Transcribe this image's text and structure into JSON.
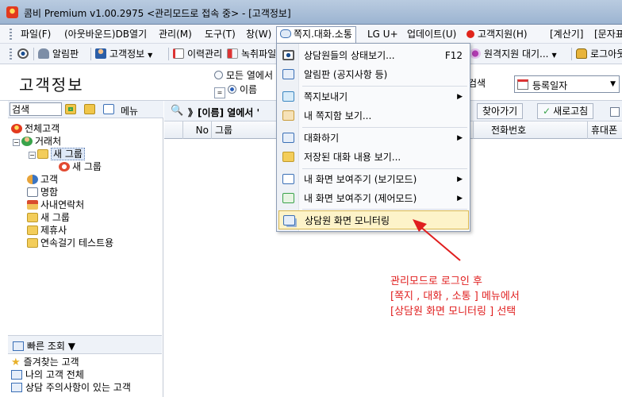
{
  "window": {
    "title": "콤비 Premium v1.00.2975 <관리모드로 접속 중> - [고객정보]"
  },
  "menubar": {
    "items": [
      {
        "label": "파일(F)"
      },
      {
        "label": "(아웃바운드)DB열기"
      },
      {
        "label": "관리(M)"
      },
      {
        "label": "도구(T)"
      },
      {
        "label": "창(W)"
      },
      {
        "label": "쪽지.대화.소통"
      },
      {
        "label": "LG U+"
      },
      {
        "label": "업데이트(U)"
      },
      {
        "label": "고객지원(H)"
      },
      {
        "label": "[계산기]"
      },
      {
        "label": "[문자표]"
      }
    ]
  },
  "toolbar": {
    "notice": "알림판",
    "customer_info": "고객정보",
    "history": "이력관리",
    "recording": "녹취파일",
    "remote": "원격지원 대기...",
    "logout": "로그아웃"
  },
  "topbar": {
    "page_title": "고객정보",
    "radio_all": "모든 열에서",
    "radio_selected": "이름",
    "right_label": "검색",
    "date_field": "등록일자"
  },
  "left": {
    "search_label": "검색",
    "menu_label": "메뉴",
    "tree": [
      {
        "label": "전체고객"
      },
      {
        "label": "거래처"
      },
      {
        "label": "새 그룹"
      },
      {
        "label": "새 그룹"
      },
      {
        "label": "고객"
      },
      {
        "label": "명함"
      },
      {
        "label": "사내연락처"
      },
      {
        "label": "새 그룹"
      },
      {
        "label": "제휴사"
      },
      {
        "label": "연속걸기 테스트용"
      }
    ],
    "quick_title": "빠른 조회 ▼",
    "quick_items": [
      {
        "label": "즐겨찾는 고객"
      },
      {
        "label": "나의 고객 전체"
      },
      {
        "label": "상담 주의사항이 있는 고객"
      }
    ]
  },
  "right": {
    "filter_hint": "》[이름] 열에서 '",
    "go_back": "찾아가기",
    "refresh": "새로고침",
    "columns": [
      {
        "label": "No"
      },
      {
        "label": "그룹"
      },
      {
        "label": "전화번호"
      },
      {
        "label": "휴대폰"
      }
    ]
  },
  "dropdown": {
    "items": [
      {
        "label": "상담원들의 상태보기...",
        "shortcut": "F12",
        "icon": "eye-icon"
      },
      {
        "label": "알림판 (공지사항 등)",
        "icon": "board-icon"
      },
      {
        "label": "쪽지보내기",
        "icon": "note-icon"
      },
      {
        "label": "내 쪽지함 보기...",
        "icon": "note-box-icon"
      },
      {
        "label": "대화하기",
        "icon": "chat-icon"
      },
      {
        "label": "저장된 대화 내용 보기...",
        "icon": "folder-icon"
      },
      {
        "label": "내 화면 보여주기 (보기모드)",
        "icon": "screen-icon"
      },
      {
        "label": "내 화면 보여주기 (제어모드)",
        "icon": "screen-control-icon"
      },
      {
        "label": "상담원 화면 모니터링",
        "icon": "monitor-icon"
      }
    ]
  },
  "annotation": {
    "line1": "관리모드로 로그인 후",
    "line2": "[쪽지 , 대화 , 소통 ] 메뉴에서",
    "line3": "[상담원 화면 모니터링 ] 선택"
  },
  "colors": {
    "annotation": "#e01e1e",
    "highlight": "#fdf3c9"
  }
}
